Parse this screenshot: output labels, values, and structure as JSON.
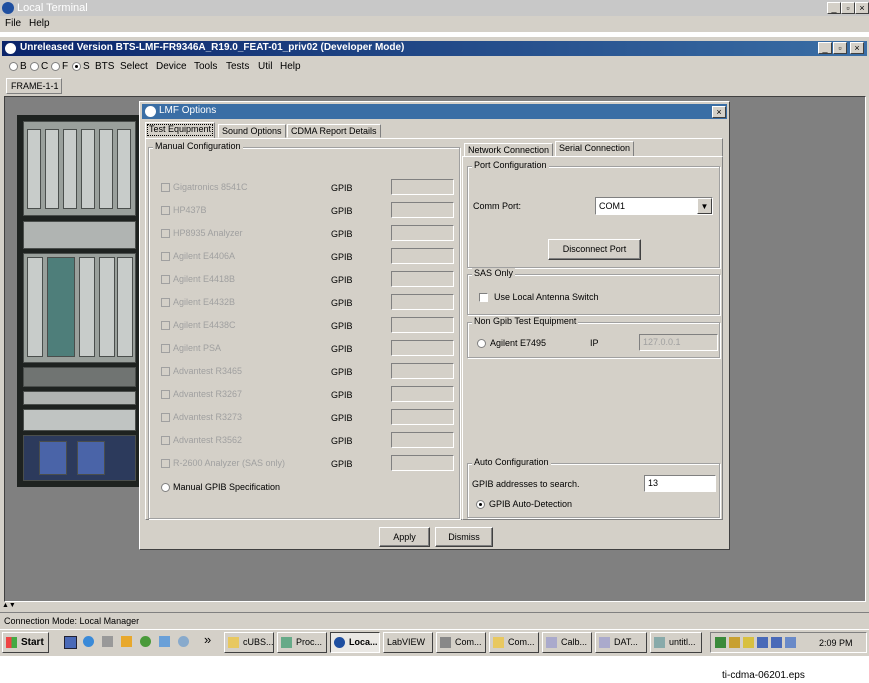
{
  "outer_window": {
    "title": "Local Terminal",
    "menu": [
      "File",
      "Help"
    ]
  },
  "inner_window": {
    "title": "Unreleased Version BTS-LMF-FR9346A_R19.0_FEAT-01_priv02 (Developer Mode)",
    "mode_radios": [
      {
        "label": "B",
        "selected": false
      },
      {
        "label": "C",
        "selected": false
      },
      {
        "label": "F",
        "selected": false
      },
      {
        "label": "S",
        "selected": true
      }
    ],
    "menu": [
      "BTS",
      "Select",
      "Device",
      "Tools",
      "Tests",
      "Util",
      "Help"
    ],
    "frame_tab": "FRAME-1-1"
  },
  "dialog": {
    "title": "LMF Options",
    "close_glyph": "×",
    "tabs": [
      "Test Equipment",
      "Sound Options",
      "CDMA Report Details"
    ],
    "manual_config": {
      "label": "Manual Configuration",
      "gpib_label": "GPIB",
      "items": [
        "Gigatronics 8541C",
        "HP437B",
        "HP8935 Analyzer",
        "Agilent E4406A",
        "Agilent E4418B",
        "Agilent E4432B",
        "Agilent E4438C",
        "Agilent PSA",
        "Advantest R3465",
        "Advantest R3267",
        "Advantest R3273",
        "Advantest R3562",
        "R-2600 Analyzer (SAS only)"
      ],
      "manual_gpib_spec": "Manual GPIB Specification"
    },
    "right_tabs": [
      "Network Connection",
      "Serial Connection"
    ],
    "port_config": {
      "label": "Port Configuration",
      "comm_port_label": "Comm Port:",
      "comm_port_value": "COM1",
      "disconnect_button": "Disconnect Port"
    },
    "sas_only": {
      "label": "SAS Only",
      "checkbox_label": "Use Local Antenna Switch"
    },
    "non_gpib": {
      "label": "Non Gpib Test Equipment",
      "radio_label": "Agilent E7495",
      "ip_label": "IP",
      "ip_value": "127.0.0.1"
    },
    "auto_config": {
      "label": "Auto Configuration",
      "search_label": "GPIB addresses to search.",
      "search_value": "13",
      "auto_detect_label": "GPIB Auto-Detection"
    },
    "buttons": {
      "apply": "Apply",
      "dismiss": "Dismiss"
    }
  },
  "status_bar": {
    "arrows": "▲▼",
    "connection_mode": "Connection Mode: Local Manager"
  },
  "taskbar": {
    "start_label": "Start",
    "chevron": "»",
    "tasks": [
      "cUBS...",
      "Proc...",
      "Loca...",
      "LabVIEW",
      "Com...",
      "Com...",
      "Calb...",
      "DAT...",
      "untitl..."
    ],
    "clock": "2:09 PM"
  },
  "caption": "ti-cdma-06201.eps",
  "colors": {
    "dialog_title": "#3a6ea5",
    "window_bg": "#d4d0c8",
    "mdi_bg": "#808080"
  }
}
